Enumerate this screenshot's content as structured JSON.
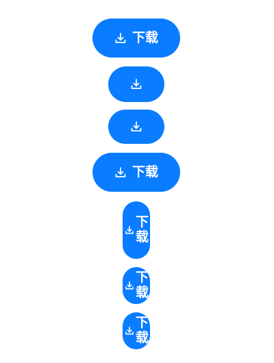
{
  "buttons": [
    {
      "label": "下载",
      "icon": "download-icon",
      "variant": "pill-with-label"
    },
    {
      "label": "",
      "icon": "download-icon",
      "variant": "icon-only"
    },
    {
      "label": "",
      "icon": "download-icon",
      "variant": "icon-only"
    },
    {
      "label": "下载",
      "icon": "download-icon",
      "variant": "pill-with-label"
    },
    {
      "label": "下载",
      "icon": "download-icon",
      "variant": "vertical-narrow"
    },
    {
      "label": "下载",
      "icon": "download-icon",
      "variant": "vertical-narrow-short"
    },
    {
      "label": "下载",
      "icon": "download-icon",
      "variant": "vertical-narrow-short"
    }
  ],
  "colors": {
    "accent": "#0a7cff",
    "text": "#ffffff",
    "background": "#ffffff"
  }
}
